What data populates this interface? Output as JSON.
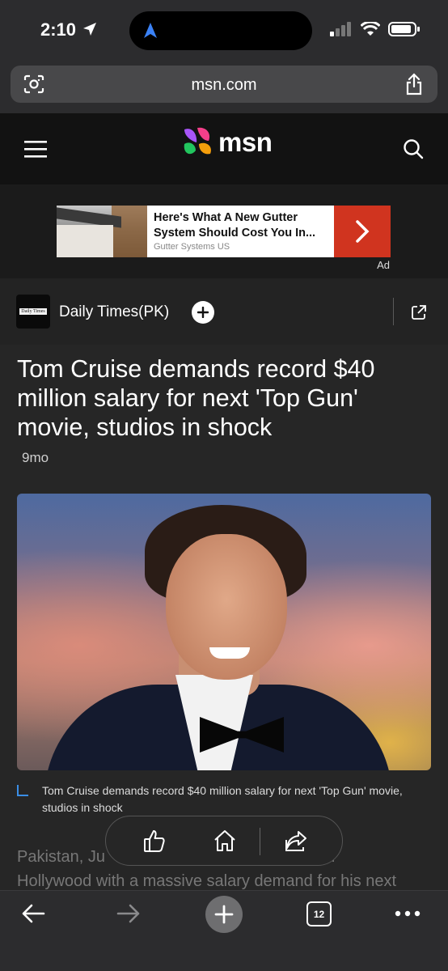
{
  "status_bar": {
    "time": "2:10"
  },
  "browser": {
    "url": "msn.com",
    "tab_count": "12"
  },
  "site": {
    "logo_text": "msn"
  },
  "ad": {
    "headline": "Here's What A New Gutter System Should Cost You In...",
    "sponsor": "Gutter Systems US",
    "label": "Ad"
  },
  "publisher": {
    "name": "Daily Times(PK)",
    "logo_text": "Daily Times"
  },
  "article": {
    "title": "Tom Cruise demands record $40 million salary for next 'Top Gun' movie, studios in shock",
    "age": "9mo",
    "caption": "Tom Cruise demands record $40 million salary for next 'Top Gun' movie, studios in shock",
    "body_line1": "Pakistan, Ju",
    "body_line1_end": "ed",
    "body_line2": "Hollywood with a massive salary demand for his next"
  },
  "icons": {
    "menu": "hamburger-icon",
    "search": "search-icon",
    "share": "share-icon",
    "like": "thumbs-up-icon",
    "home": "home-icon"
  },
  "colors": {
    "ad_cta": "#d0341f",
    "caption_accent": "#3a8ee6"
  }
}
